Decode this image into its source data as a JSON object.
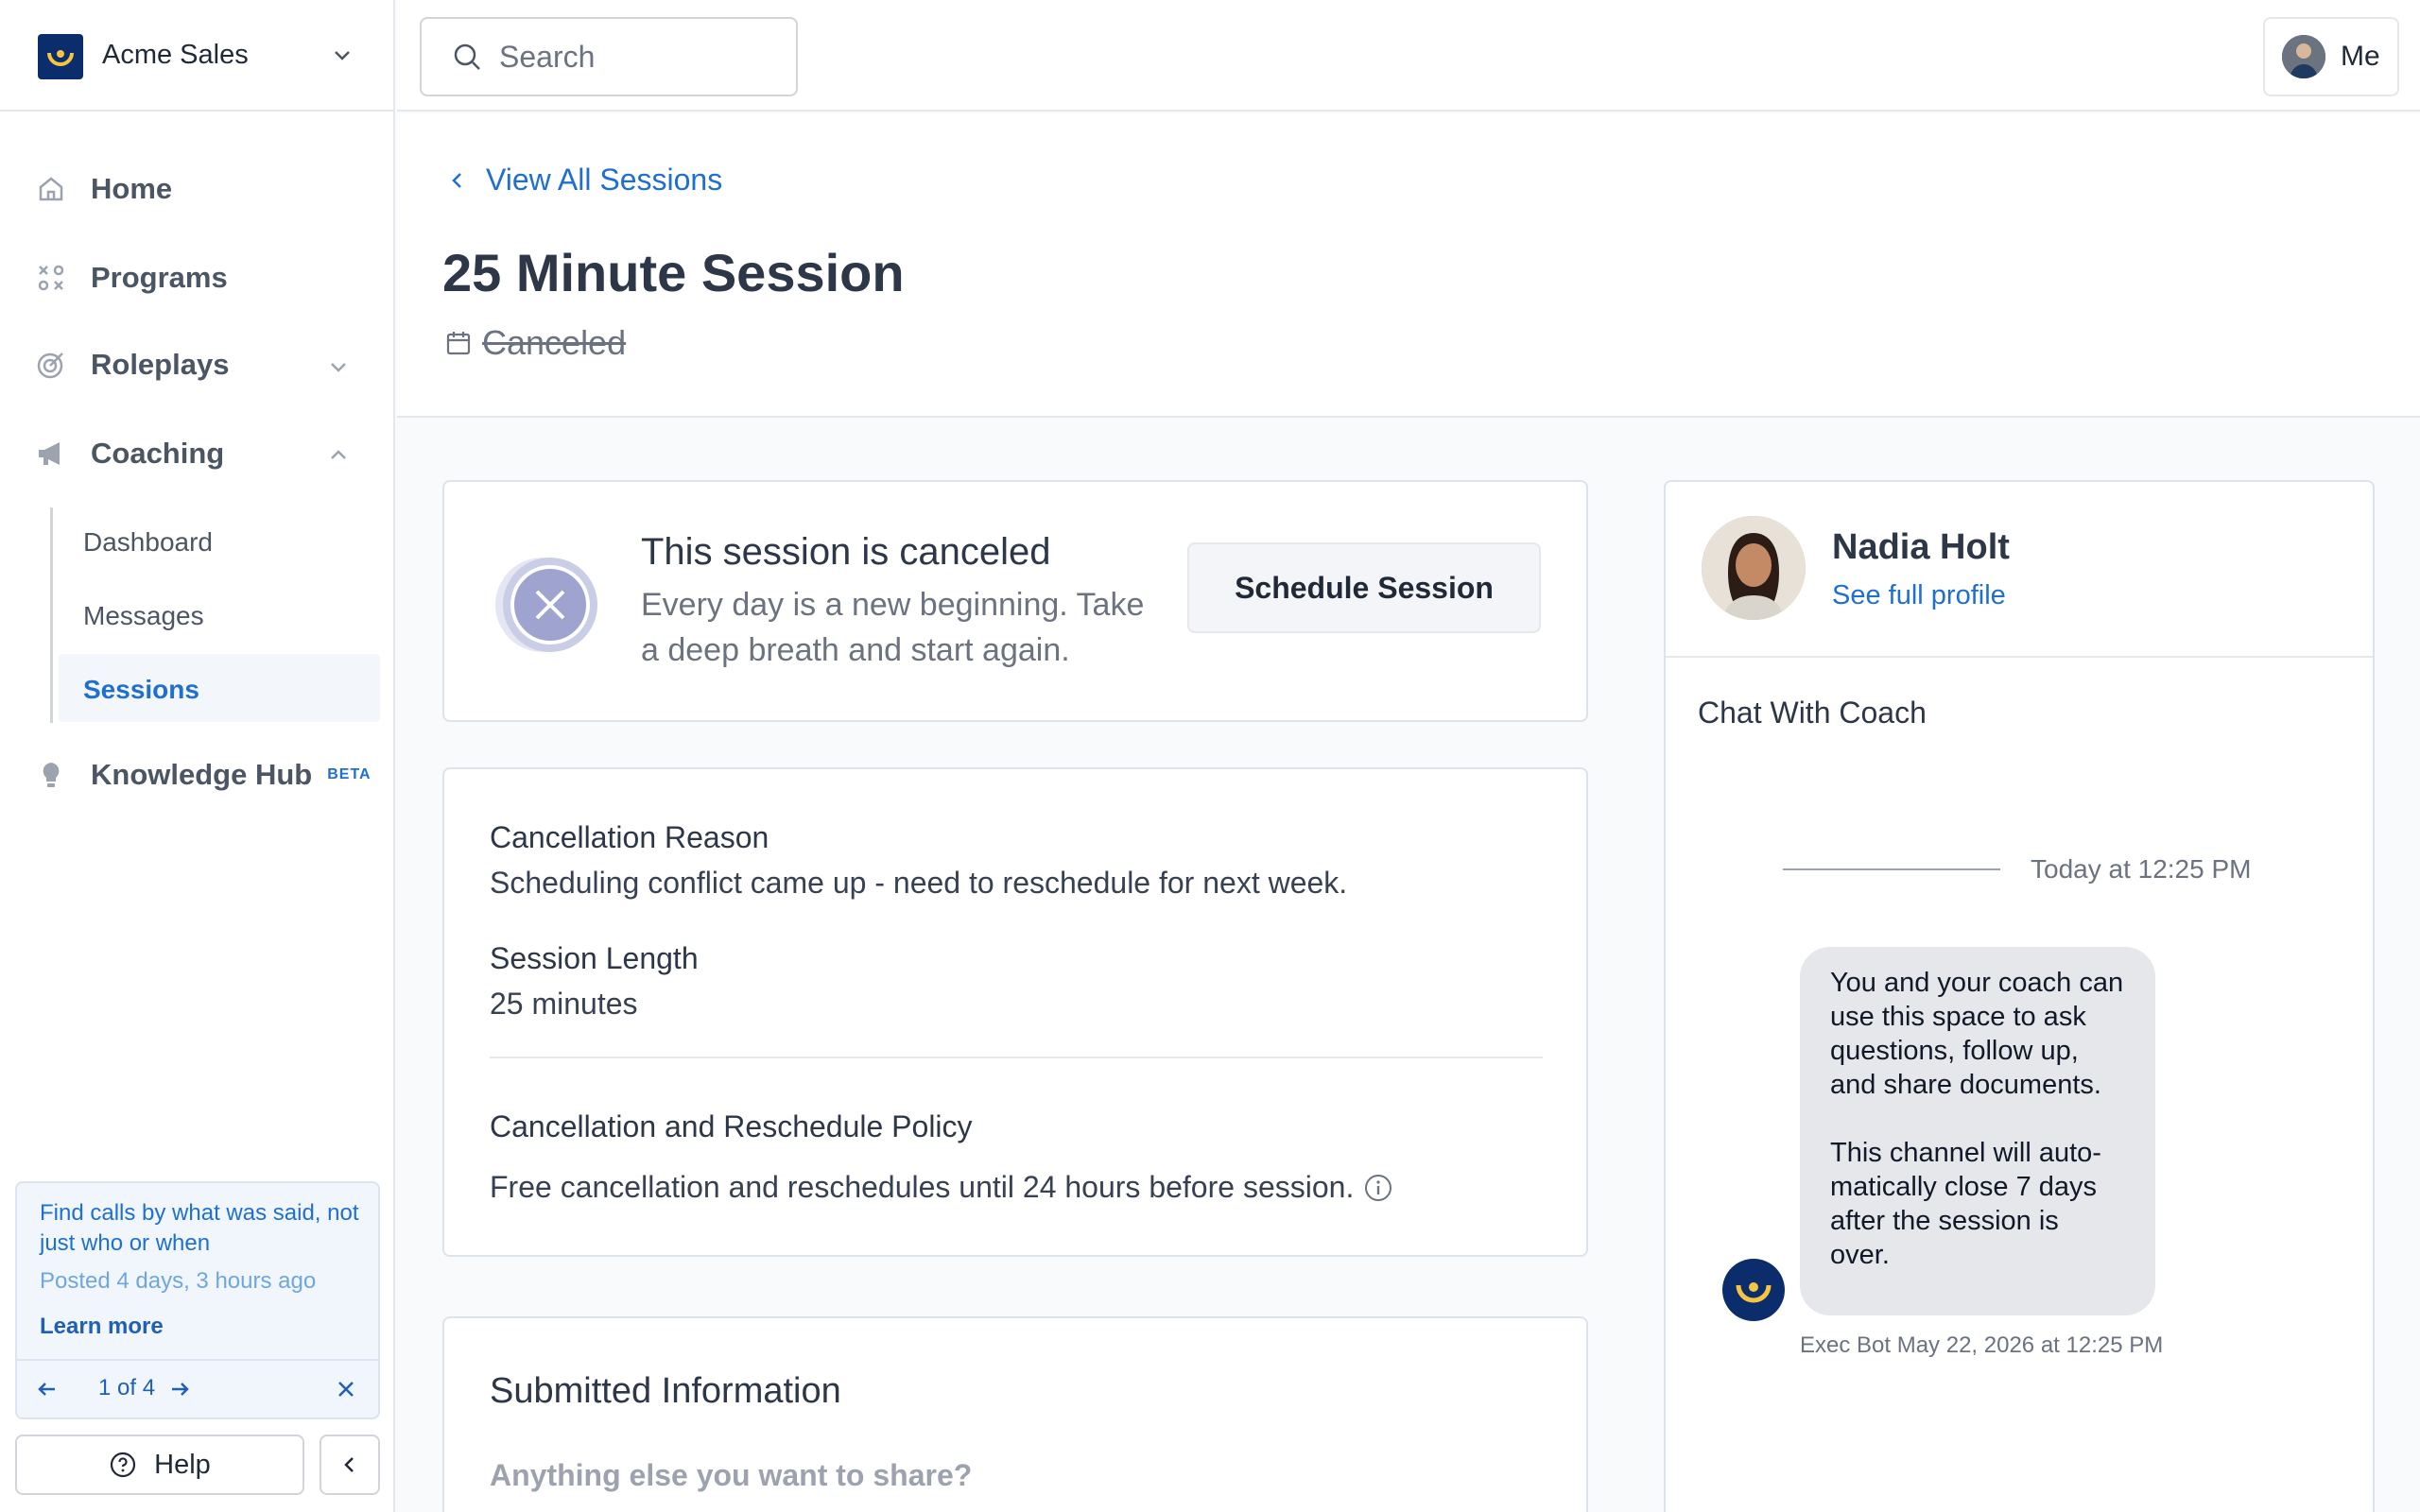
{
  "brand": {
    "name": "Acme Sales"
  },
  "search": {
    "placeholder": "Search"
  },
  "user_menu": {
    "label": "Me"
  },
  "nav": {
    "home": "Home",
    "programs": "Programs",
    "roleplays": "Roleplays",
    "coaching": "Coaching",
    "coaching_sub": [
      "Dashboard",
      "Messages",
      "Sessions"
    ],
    "knowledge_hub": "Knowledge Hub",
    "beta": "BETA"
  },
  "tip": {
    "title": "Find calls by what was said, not just who or when",
    "posted": "Posted 4 days, 3 hours ago",
    "learn_more": "Learn more",
    "pager": "1 of 4"
  },
  "help": {
    "label": "Help"
  },
  "page": {
    "back_link": "View All Sessions",
    "title": "25 Minute Session",
    "status": "Canceled"
  },
  "cancel_card": {
    "title": "This session is canceled",
    "text": "Every day is a new beginning. Take a deep breath and start again.",
    "button": "Schedule Session"
  },
  "details": {
    "reason_label": "Cancellation Reason",
    "reason_value": "Scheduling conflict came up - need to reschedule for next week.",
    "length_label": "Session Length",
    "length_value": "25 minutes",
    "policy_label": "Cancellation and Reschedule Policy",
    "policy_value": "Free cancellation and reschedules until 24 hours before session."
  },
  "submitted": {
    "title": "Submitted Information",
    "question": "Anything else you want to share?"
  },
  "coach": {
    "name": "Nadia Holt",
    "profile_link": "See full profile",
    "chat_title": "Chat With Coach",
    "timestamp": "Today at 12:25 PM",
    "message": "You and your coach can use this space to ask questions, follow up, and share documents.\n\nThis channel will auto-matically close 7 days after the session is over.",
    "message_meta": "Exec Bot May 22, 2026 at 12:25 PM"
  },
  "colors": {
    "accent": "#1f6fd1",
    "brand_navy": "#0b2d6b",
    "brand_yellow": "#f5c542"
  }
}
